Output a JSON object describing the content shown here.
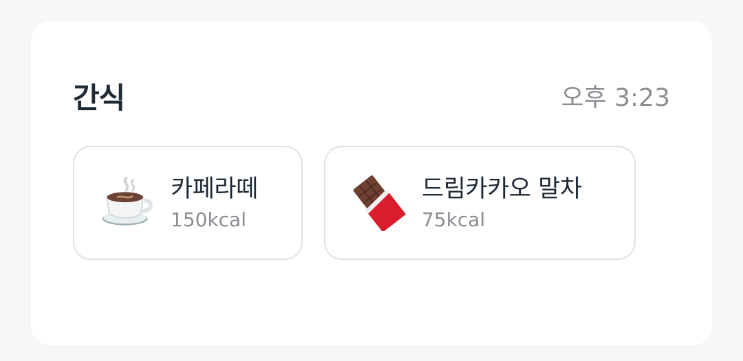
{
  "meal": {
    "title": "간식",
    "time": "오후 3:23"
  },
  "items": [
    {
      "name": "카페라떼",
      "kcal": "150kcal",
      "icon": "coffee-cup-icon"
    },
    {
      "name": "드림카카오 말차",
      "kcal": "75kcal",
      "icon": "chocolate-bar-icon"
    }
  ],
  "colors": {
    "background": "#f6f7f9",
    "card": "#ffffff",
    "text_primary": "#1f2a37",
    "text_secondary": "#8a8d92",
    "border": "#dfe2e6"
  }
}
